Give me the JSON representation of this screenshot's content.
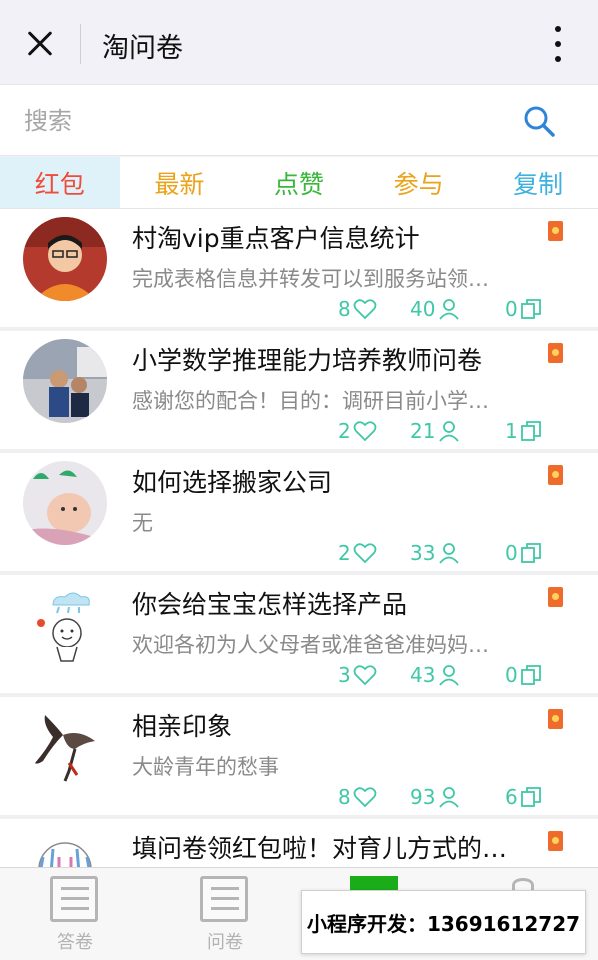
{
  "header": {
    "title": "淘问卷"
  },
  "search": {
    "placeholder": "搜索"
  },
  "tabs": [
    {
      "label": "红包",
      "color": "#ef4c3a",
      "active": true
    },
    {
      "label": "最新",
      "color": "#eba31c"
    },
    {
      "label": "点赞",
      "color": "#38b73a"
    },
    {
      "label": "参与",
      "color": "#eba31c"
    },
    {
      "label": "复制",
      "color": "#3fb1df"
    }
  ],
  "colors": {
    "accent_stats": "#3fc8a6",
    "red_packet_badge": "#ef6b2b",
    "search_icon": "#2e85d6"
  },
  "items": [
    {
      "title": "村淘vip重点客户信息统计",
      "desc": "完成表格信息并转发可以到服务站领…",
      "likes": "8",
      "participants": "40",
      "copies": "0",
      "icons": [
        "heart-icon",
        "person-icon",
        "copy-icon"
      ]
    },
    {
      "title": "小学数学推理能力培养教师问卷",
      "desc": "感谢您的配合！目的：调研目前小学…",
      "likes": "2",
      "participants": "21",
      "copies": "1"
    },
    {
      "title": "如何选择搬家公司",
      "desc": "无",
      "likes": "2",
      "participants": "33",
      "copies": "0"
    },
    {
      "title": "你会给宝宝怎样选择产品",
      "desc": "欢迎各初为人父母者或准爸爸准妈妈…",
      "likes": "3",
      "participants": "43",
      "copies": "0"
    },
    {
      "title": "相亲印象",
      "desc": "大龄青年的愁事",
      "likes": "8",
      "participants": "93",
      "copies": "6"
    },
    {
      "title": "填问卷领红包啦！对育儿方式的…",
      "desc": "",
      "likes": "",
      "participants": "",
      "copies": ""
    }
  ],
  "bottom_nav": [
    {
      "label": "答卷",
      "icon": "questionnaire-icon"
    },
    {
      "label": "问卷",
      "icon": "survey-list-icon"
    }
  ],
  "overlay": {
    "text": "小程序开发：13691612727"
  }
}
